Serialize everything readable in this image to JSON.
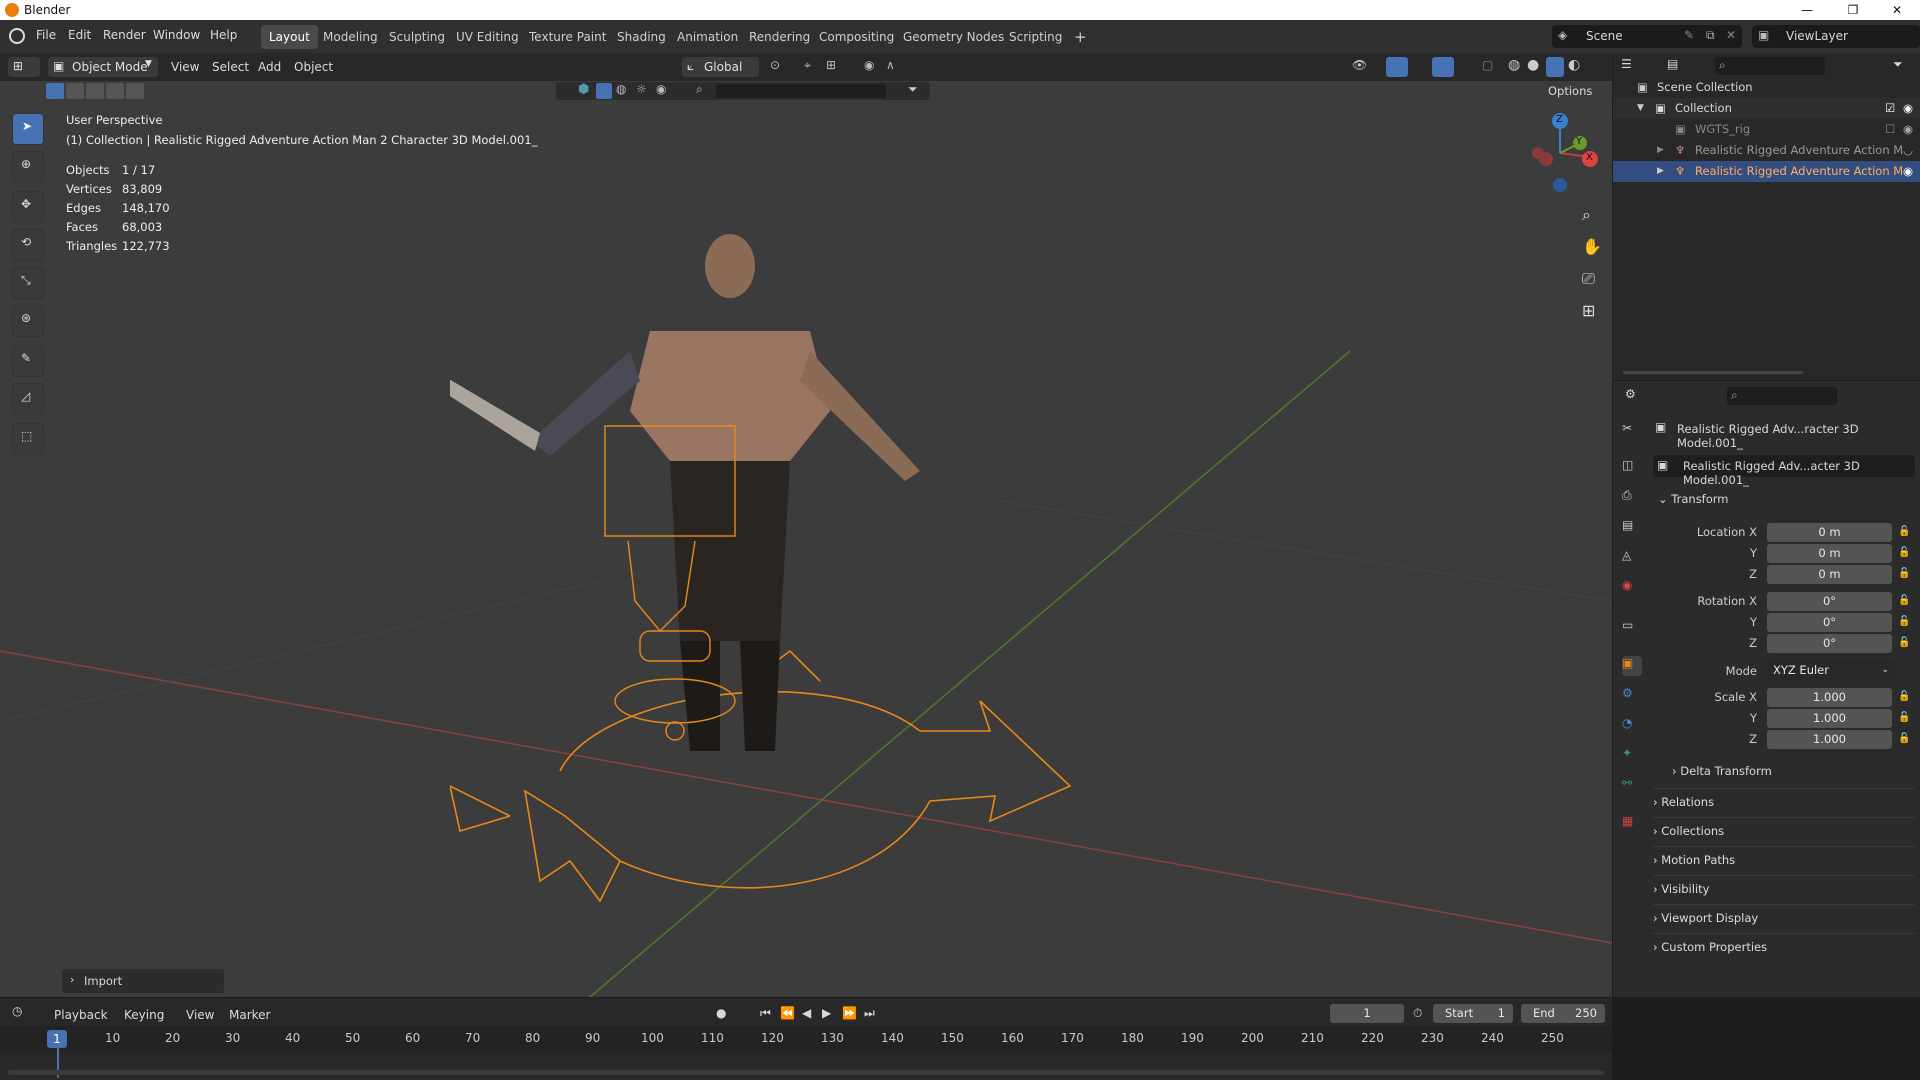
{
  "app": {
    "title": "Blender"
  },
  "menu": {
    "items": [
      "File",
      "Edit",
      "Render",
      "Window",
      "Help"
    ]
  },
  "workspaces": {
    "tabs": [
      "Layout",
      "Modeling",
      "Sculpting",
      "UV Editing",
      "Texture Paint",
      "Shading",
      "Animation",
      "Rendering",
      "Compositing",
      "Geometry Nodes",
      "Scripting"
    ],
    "active": "Layout",
    "add": "+"
  },
  "scene": {
    "name": "Scene",
    "viewlayer": "ViewLayer"
  },
  "viewport_header": {
    "mode": "Object Mode",
    "menus": [
      "View",
      "Select",
      "Add",
      "Object"
    ],
    "orientation": "Global",
    "options": "Options"
  },
  "viewport": {
    "perspective": "User Perspective",
    "collection_line": "(1) Collection | Realistic Rigged Adventure Action Man 2 Character 3D Model.001_",
    "stats": [
      {
        "label": "Objects",
        "value": "1 / 17"
      },
      {
        "label": "Vertices",
        "value": "83,809"
      },
      {
        "label": "Edges",
        "value": "148,170"
      },
      {
        "label": "Faces",
        "value": "68,003"
      },
      {
        "label": "Triangles",
        "value": "122,773"
      }
    ],
    "import_panel": "Import",
    "gizmo": {
      "z": "Z",
      "y": "Y",
      "x": "X"
    }
  },
  "outliner": {
    "root": "Scene Collection",
    "items": [
      {
        "label": "Collection"
      },
      {
        "label": "WGTS_rig"
      },
      {
        "label": "Realistic Rigged Adventure Action M"
      },
      {
        "label": "Realistic Rigged Adventure Action M"
      }
    ]
  },
  "properties": {
    "object_name": "Realistic Rigged Adv...racter 3D Model.001_",
    "object_data_name": "Realistic Rigged Adv...acter 3D Model.001_",
    "transform_header": "Transform",
    "location": {
      "label": "Location X",
      "x": "0 m",
      "y": "0 m",
      "z": "0 m"
    },
    "rotation": {
      "label": "Rotation X",
      "x": "0°",
      "y": "0°",
      "z": "0°"
    },
    "mode": {
      "label": "Mode",
      "value": "XYZ Euler"
    },
    "scale": {
      "label": "Scale X",
      "x": "1.000",
      "y": "1.000",
      "z": "1.000"
    },
    "axis": {
      "y": "Y",
      "z": "Z"
    },
    "delta": "Delta Transform",
    "panels": [
      "Relations",
      "Collections",
      "Motion Paths",
      "Visibility",
      "Viewport Display",
      "Custom Properties"
    ]
  },
  "timeline": {
    "menus": [
      "Playback",
      "Keying",
      "View",
      "Marker"
    ],
    "current_frame": "1",
    "start_label": "Start",
    "start": "1",
    "end_label": "End",
    "end": "250",
    "ticks": [
      "10",
      "20",
      "30",
      "40",
      "50",
      "60",
      "70",
      "80",
      "90",
      "100",
      "110",
      "120",
      "130",
      "140",
      "150",
      "160",
      "170",
      "180",
      "190",
      "200",
      "210",
      "220",
      "230",
      "240",
      "250"
    ]
  },
  "colors": {
    "accent": "#4672b4",
    "selection": "#e8881a",
    "bg": "#3c3c3c"
  }
}
